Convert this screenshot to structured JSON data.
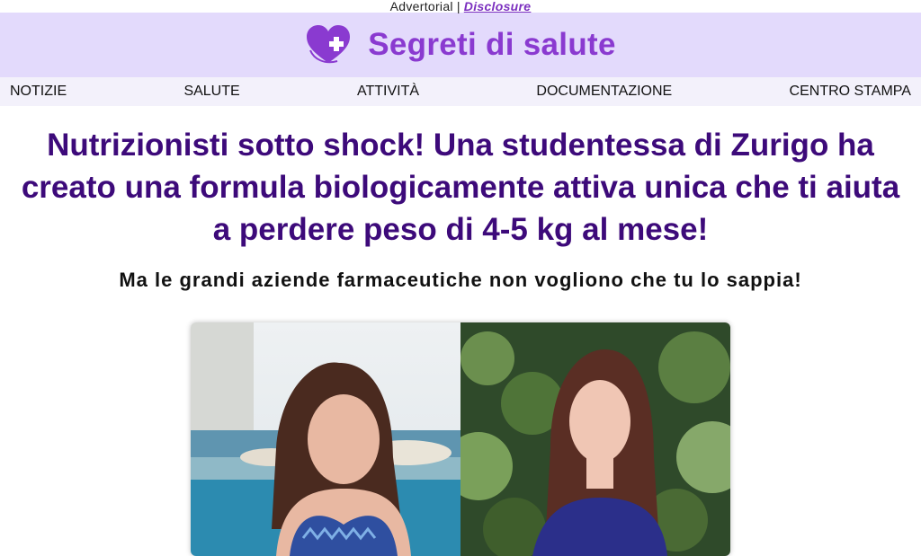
{
  "topbar": {
    "advertorial": "Advertorial",
    "separator": "|",
    "disclosure": "Disclosure"
  },
  "header": {
    "site_name": "Segreti di salute",
    "logo_icon": "heart-plus-icon"
  },
  "nav": {
    "items": [
      {
        "label": "NOTIZIE"
      },
      {
        "label": "SALUTE"
      },
      {
        "label": "ATTIVITÀ"
      },
      {
        "label": "DOCUMENTAZIONE"
      },
      {
        "label": "CENTRO STAMPA"
      }
    ]
  },
  "article": {
    "headline": "Nutrizionisti sotto shock! Una studentessa di Zurigo ha creato una formula biologicamente attiva unica che ti aiuta a perdere peso di 4-5 kg al mese!",
    "subheadline": "Ma le grandi aziende farmaceutiche non vogliono che tu lo sappia!"
  },
  "colors": {
    "accent": "#8a3ad0",
    "headline": "#3d0a7a",
    "header_bg": "#e3dafc"
  }
}
